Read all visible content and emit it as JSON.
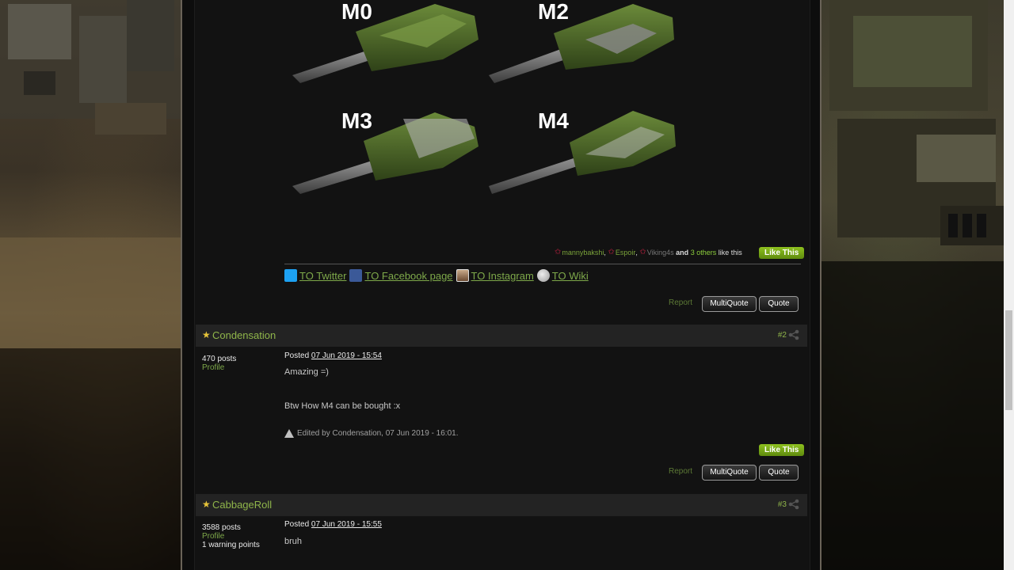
{
  "weapon_labels": [
    "M0",
    "M2",
    "M3",
    "M4"
  ],
  "likes": {
    "users": [
      "mannybakshi",
      "Espoir",
      "Viking4s"
    ],
    "separator": ",",
    "and": "and",
    "others": "3 others",
    "suffix": "like this",
    "button": "Like This"
  },
  "social_links": [
    {
      "label": "TO Twitter",
      "icon": "twitter-icon"
    },
    {
      "label": "TO Facebook page",
      "icon": "facebook-icon"
    },
    {
      "label": "TO Instagram",
      "icon": "instagram-icon"
    },
    {
      "label": "TO Wiki",
      "icon": "wiki-icon"
    }
  ],
  "actions": {
    "report": "Report",
    "multiquote": "MultiQuote",
    "quote": "Quote"
  },
  "posts": [
    {
      "author": "Condensation",
      "number": "#2",
      "posts_count": "470 posts",
      "profile": "Profile",
      "posted_label": "Posted",
      "posted_date": "07 Jun 2019 - 15:54",
      "lines": [
        "Amazing =)",
        "Btw  How M4 can be bought :x"
      ],
      "edited": "Edited by Condensation, 07 Jun 2019 - 16:01.",
      "like_button": "Like This"
    },
    {
      "author": "CabbageRoll",
      "number": "#3",
      "posts_count": "3588 posts",
      "profile": "Profile",
      "warning": "1 warning points",
      "posted_label": "Posted",
      "posted_date": "07 Jun 2019 - 15:55",
      "lines": [
        "bruh"
      ]
    }
  ],
  "colors": {
    "accent_green": "#8fb54a",
    "like_green": "#7aa818",
    "star_gold": "#e6c43a"
  }
}
